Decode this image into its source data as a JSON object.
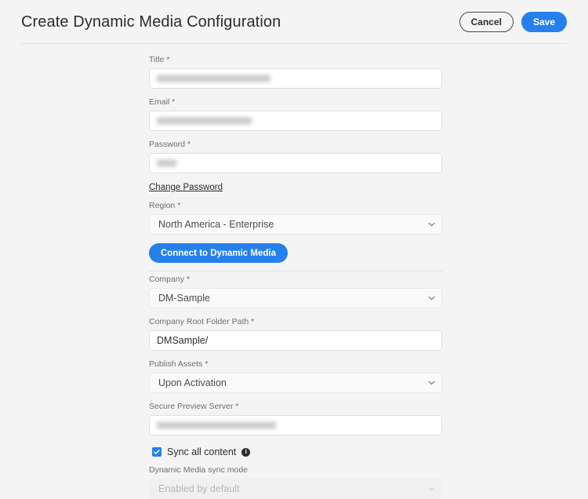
{
  "header": {
    "title": "Create Dynamic Media Configuration",
    "cancel_label": "Cancel",
    "save_label": "Save"
  },
  "colors": {
    "accent_blue": "#2680eb",
    "page_background": "#f4f4f4",
    "input_background": "#ffffff",
    "select_background": "#fafafa",
    "disabled_background": "#f0f0f0",
    "label_text": "#6e6e6e",
    "body_text": "#2c2c2c"
  },
  "form": {
    "title_field": {
      "label": "Title *",
      "value": "",
      "redacted": true,
      "redacted_width": 145
    },
    "email_field": {
      "label": "Email *",
      "value": "",
      "redacted": true,
      "redacted_width": 121
    },
    "password_field": {
      "label": "Password *",
      "value": "",
      "redacted": true,
      "redacted_width": 25
    },
    "change_password_link": "Change Password",
    "region_field": {
      "label": "Region *",
      "value": "North America - Enterprise"
    },
    "connect_button": "Connect to Dynamic Media",
    "company_field": {
      "label": "Company *",
      "value": "DM-Sample"
    },
    "company_root_folder_path_field": {
      "label": "Company Root Folder Path *",
      "value": "DMSample/"
    },
    "publish_assets_field": {
      "label": "Publish Assets *",
      "value": "Upon Activation"
    },
    "secure_preview_server_field": {
      "label": "Secure Preview Server *",
      "value": "",
      "redacted": true,
      "redacted_width": 152
    },
    "sync_all_content": {
      "label": "Sync all content",
      "checked": true,
      "info_icon": "info-icon"
    },
    "dynamic_media_sync_mode_field": {
      "label": "Dynamic Media sync mode",
      "value": "Enabled by default",
      "disabled": true
    }
  }
}
